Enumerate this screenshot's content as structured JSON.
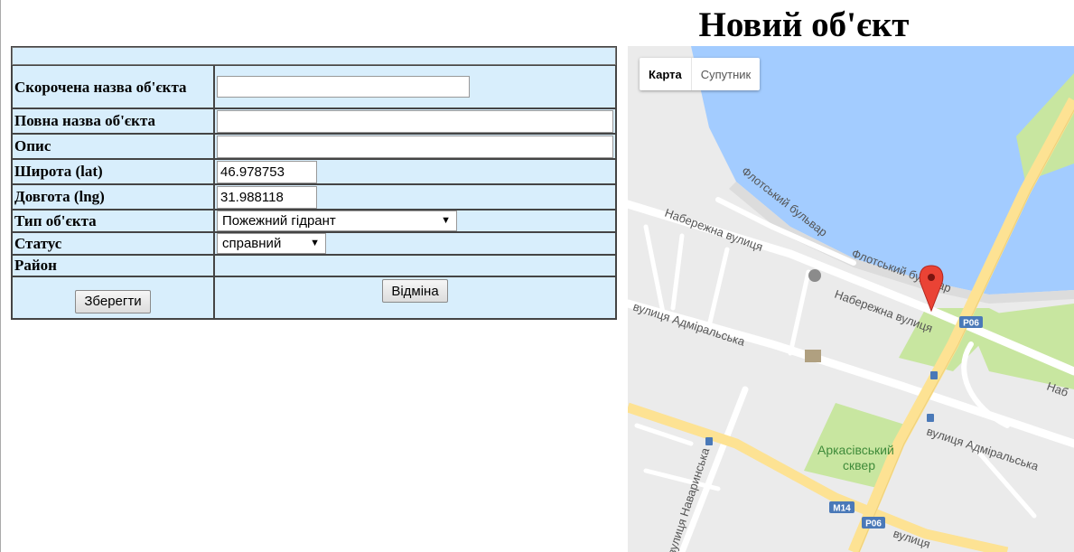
{
  "page": {
    "title": "Новий об'єкт"
  },
  "form": {
    "fields": {
      "short_name": {
        "label": "Скорочена назва об'єкта",
        "value": ""
      },
      "full_name": {
        "label": "Повна назва об'єкта",
        "value": ""
      },
      "description": {
        "label": "Опис",
        "value": ""
      },
      "lat": {
        "label": "Широта (lat)",
        "value": "46.978753"
      },
      "lng": {
        "label": "Довгота (lng)",
        "value": "31.988118"
      },
      "type": {
        "label": "Тип об'єкта",
        "value": "Пожежний гідрант"
      },
      "status": {
        "label": "Статус",
        "value": "справний"
      },
      "district": {
        "label": "Район",
        "value": ""
      }
    },
    "save_label": "Зберегти",
    "cancel_label": "Відміна"
  },
  "map": {
    "maptype": {
      "map": "Карта",
      "satellite": "Супутник"
    },
    "labels": {
      "flotskyi_1": "Флотський бульвар",
      "flotskyi_2": "Флотський бульвар",
      "naberezhna_1": "Набережна вулиця",
      "naberezhna_2": "Набережна вулиця",
      "naberezhna_3": "Наб",
      "admiralska_1": "вулиця Адміральська",
      "admiralska_2": "вулиця Адміральська",
      "admiralska_3": "вулиця",
      "navarinska": "вулиця Наваринська",
      "park_1": "Аркасівський",
      "park_2": "сквер",
      "shield_p06_a": "P06",
      "shield_p06_b": "P06",
      "shield_m14": "M14"
    },
    "colors": {
      "water": "#a3ccff",
      "park": "#c8e6a0",
      "highway": "#fde293",
      "road": "#ffffff",
      "land": "#ebebeb",
      "marker": "#ea4335"
    }
  }
}
